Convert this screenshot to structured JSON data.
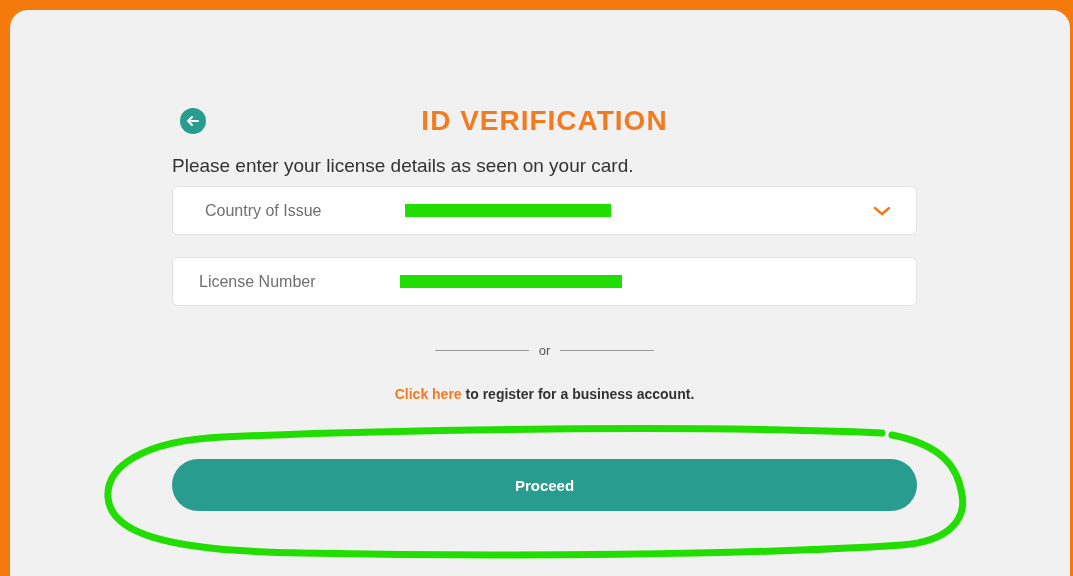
{
  "header": {
    "title": "ID VERIFICATION"
  },
  "instructions": "Please enter your license details as seen on your card.",
  "fields": [
    {
      "kind": "select",
      "placeholder": "Country of Issue",
      "redacted": true
    },
    {
      "kind": "text",
      "placeholder": "License Number",
      "redacted": true
    }
  ],
  "divider": {
    "label": "or"
  },
  "register": {
    "link": "Click here",
    "text": " to register for a business account."
  },
  "proceed_button": {
    "label": "Proceed",
    "circled": true
  }
}
